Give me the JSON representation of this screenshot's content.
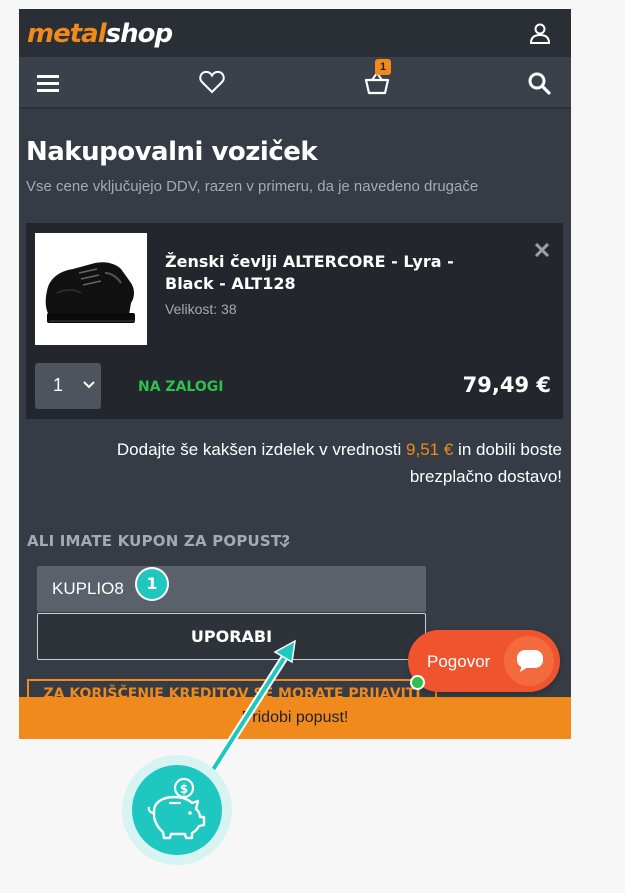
{
  "header": {
    "logo_part1": "metal",
    "logo_part2": "shop",
    "cart_count": "1"
  },
  "cart": {
    "title": "Nakupovalni voziček",
    "subtitle": "Vse cene vključujejo DDV, razen v primeru, da je navedeno drugače",
    "item": {
      "name": "Ženski čevlji ALTERCORE - Lyra - Black - ALT128",
      "size": "Velikost: 38",
      "quantity": "1",
      "stock": "NA ZALOGI",
      "price": "79,49 €"
    },
    "shipping_note_before": "Dodajte še kakšen izdelek v vrednosti ",
    "shipping_note_amount": "9,51 €",
    "shipping_note_after": " in dobili boste brezplačno dostavo!"
  },
  "coupon": {
    "toggle_label": "ALI IMATE KUPON ZA POPUST?",
    "input_value": "KUPLIO8",
    "apply_label": "UPORABI",
    "credit_label": "ZA KORIŠČENJE KREDITOV SE MORATE PRIJAVITI"
  },
  "promo": {
    "label": "Pridobi popust!"
  },
  "chat": {
    "label": "Pogovor"
  },
  "annotation": {
    "step": "1"
  },
  "colors": {
    "accent": "#f08a1c",
    "stock": "#2ec04e",
    "chat": "#f0542f",
    "annotation": "#1ec7c0"
  },
  "icons": [
    "user-icon",
    "menu-icon",
    "heart-icon",
    "basket-icon",
    "search-icon",
    "close-icon",
    "chevron-down-icon",
    "chat-icon",
    "piggy-bank-icon"
  ]
}
